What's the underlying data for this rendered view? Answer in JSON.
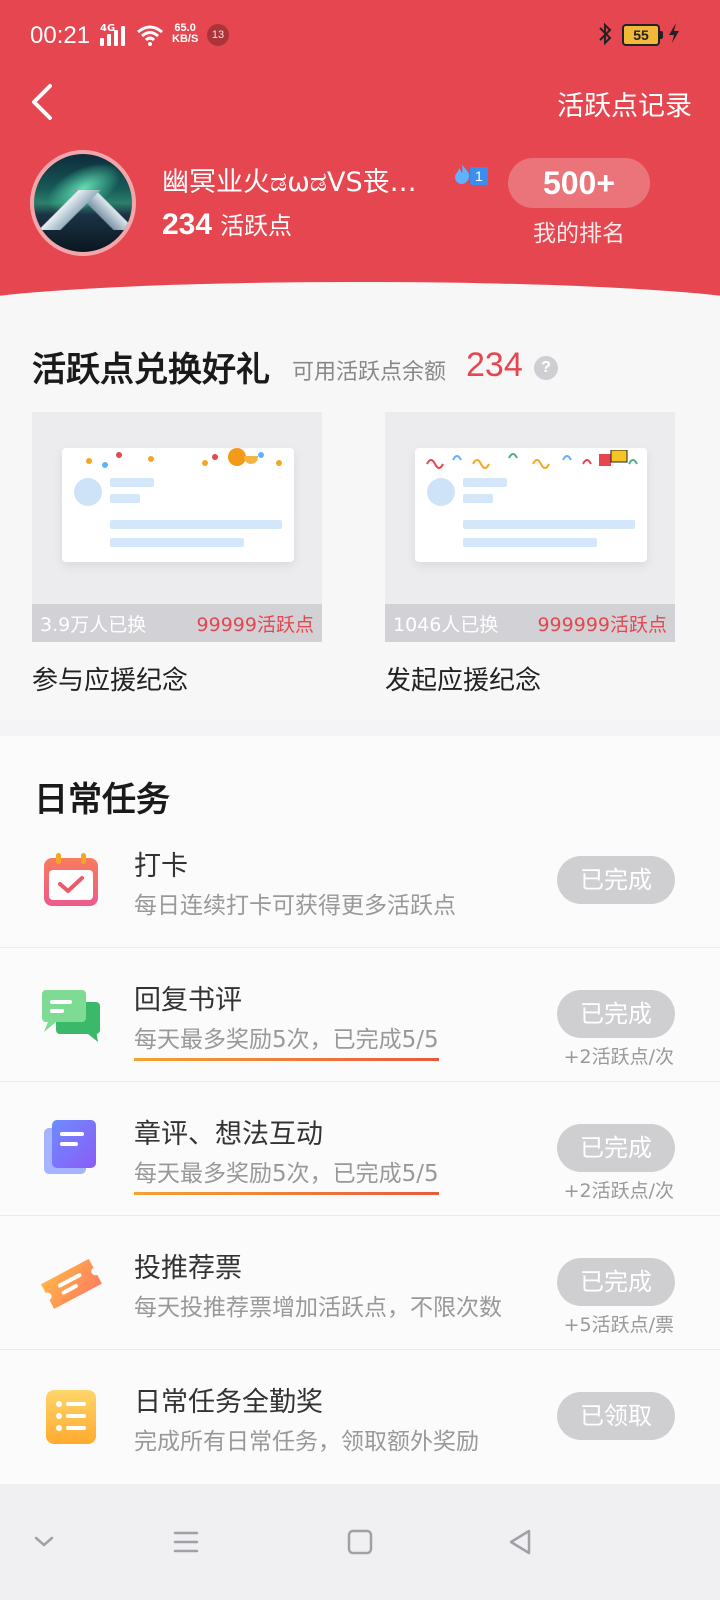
{
  "status_bar": {
    "time": "00:21",
    "network_type": "4G",
    "speed_value": "65.0",
    "speed_unit": "KB/S",
    "notification_count": "13",
    "battery_level": "55"
  },
  "header": {
    "record_link": "活跃点记录",
    "username": "幽冥业火ಡωಡVS丧…",
    "fan_level": "1",
    "points_value": "234",
    "points_unit": "活跃点",
    "rank_value": "500+",
    "rank_label": "我的排名",
    "bg_color": "#e5464f"
  },
  "exchange": {
    "title": "活跃点兑换好礼",
    "balance_label": "可用活跃点余额",
    "balance_value": "234",
    "help_icon": "?",
    "gifts": [
      {
        "name": "参与应援纪念",
        "exchanged": "3.9万人已换",
        "cost": "99999活跃点"
      },
      {
        "name": "发起应援纪念",
        "exchanged": "1046人已换",
        "cost": "999999活跃点"
      }
    ]
  },
  "daily_tasks": {
    "title": "日常任务",
    "items": [
      {
        "name": "打卡",
        "desc": "每日连续打卡可获得更多活跃点",
        "button": "已完成",
        "reward": "",
        "icon": "calendar-check-icon"
      },
      {
        "name": "回复书评",
        "desc": "每天最多奖励5次，已完成5/5",
        "button": "已完成",
        "reward": "+2活跃点/次",
        "icon": "chat-bubble-icon"
      },
      {
        "name": "章评、想法互动",
        "desc": "每天最多奖励5次，已完成5/5",
        "button": "已完成",
        "reward": "+2活跃点/次",
        "icon": "document-icon"
      },
      {
        "name": "投推荐票",
        "desc": "每天投推荐票增加活跃点，不限次数",
        "button": "已完成",
        "reward": "+5活跃点/票",
        "icon": "ticket-icon"
      },
      {
        "name": "日常任务全勤奖",
        "desc": "完成所有日常任务，领取额外奖励",
        "button": "已领取",
        "reward": "",
        "icon": "list-icon"
      }
    ]
  },
  "accent_color": "#e5464f"
}
